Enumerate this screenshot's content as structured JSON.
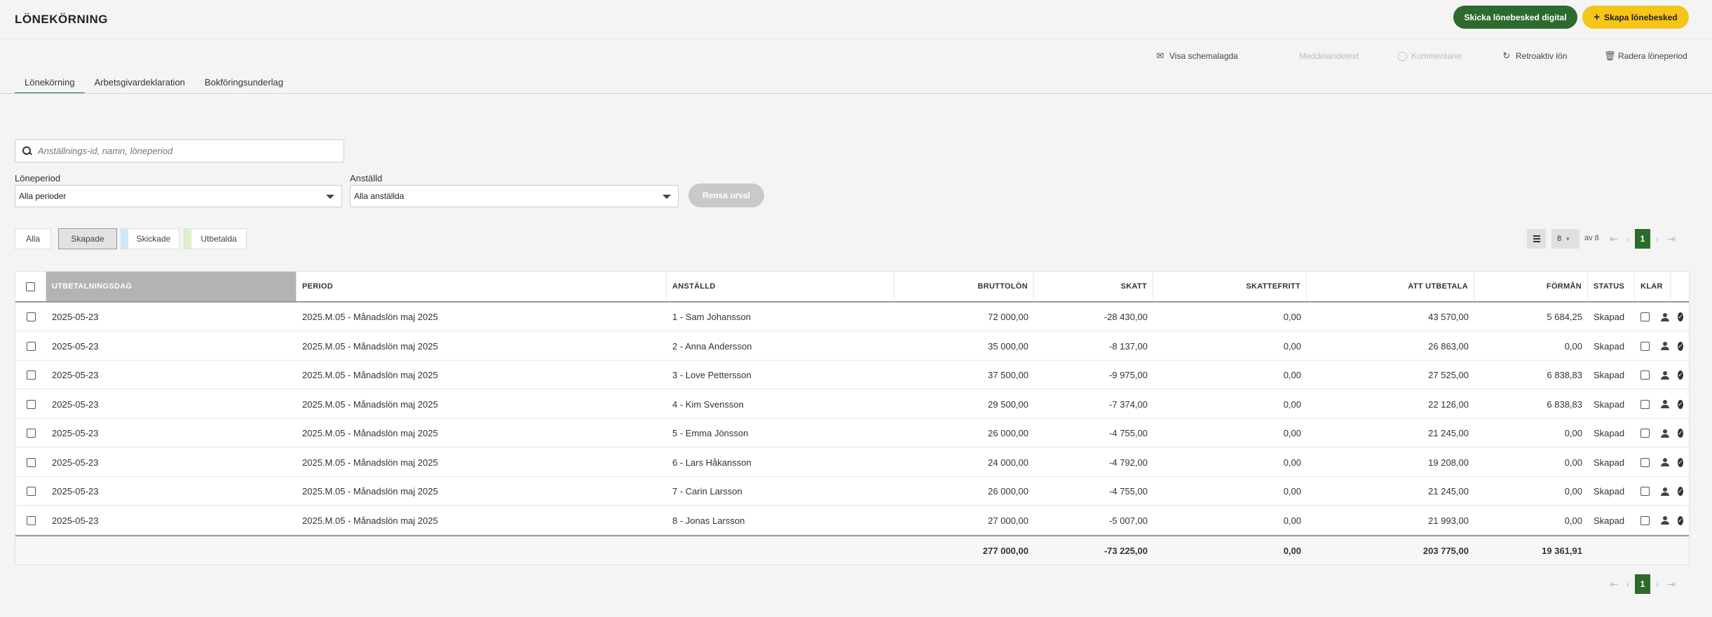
{
  "header": {
    "title": "LÖNEKÖRNING",
    "send_digital_label": "Skicka lönebesked digital",
    "create_label": "Skapa lönebesked"
  },
  "actions": [
    {
      "label": "Visa schemalagda",
      "icon": "envelope-icon",
      "enabled": true
    },
    {
      "label": "Meddelandetext",
      "icon": "",
      "enabled": false
    },
    {
      "label": "Kommentarer",
      "icon": "comment-icon",
      "enabled": false
    },
    {
      "label": "Retroaktiv lön",
      "icon": "refresh-icon",
      "enabled": true
    },
    {
      "label": "Radera löneperiod",
      "icon": "trash-icon",
      "enabled": true
    }
  ],
  "tabs": [
    {
      "label": "Lönekörning",
      "active": true
    },
    {
      "label": "Arbetsgivardeklaration",
      "active": false
    },
    {
      "label": "Bokföringsunderlag",
      "active": false
    }
  ],
  "search": {
    "placeholder": "Anställnings-id, namn, löneperiod"
  },
  "filters": {
    "period_label": "Löneperiod",
    "period_value": "Alla perioder",
    "employee_label": "Anställd",
    "employee_value": "Alla anställda",
    "clear_label": "Rensa urval"
  },
  "status_chips": [
    {
      "label": "Alla",
      "color": "",
      "active": false
    },
    {
      "label": "Skapade",
      "color": "",
      "active": true
    },
    {
      "label": "Skickade",
      "color": "#cfe6f7",
      "active": false
    },
    {
      "label": "Utbetalda",
      "color": "#dff0c9",
      "active": false
    }
  ],
  "pagination": {
    "per_page": "8",
    "of_text": "av 8",
    "current_page": "1"
  },
  "table": {
    "columns": [
      "UTBETALNINGSDAG",
      "PERIOD",
      "ANSTÄLLD",
      "BRUTTOLÖN",
      "SKATT",
      "SKATTEFRITT",
      "ATT UTBETALA",
      "FÖRMÅN",
      "STATUS",
      "KLAR"
    ],
    "rows": [
      {
        "date": "2025-05-23",
        "period": "2025.M.05 - Månadslön maj 2025",
        "employee": "1 - Sam Johansson",
        "gross": "72 000,00",
        "tax": "-28 430,00",
        "taxfree": "0,00",
        "pay": "43 570,00",
        "benefit": "5 684,25",
        "status": "Skapad"
      },
      {
        "date": "2025-05-23",
        "period": "2025.M.05 - Månadslön maj 2025",
        "employee": "2 - Anna Andersson",
        "gross": "35 000,00",
        "tax": "-8 137,00",
        "taxfree": "0,00",
        "pay": "26 863,00",
        "benefit": "0,00",
        "status": "Skapad"
      },
      {
        "date": "2025-05-23",
        "period": "2025.M.05 - Månadslön maj 2025",
        "employee": "3 - Love Pettersson",
        "gross": "37 500,00",
        "tax": "-9 975,00",
        "taxfree": "0,00",
        "pay": "27 525,00",
        "benefit": "6 838,83",
        "status": "Skapad"
      },
      {
        "date": "2025-05-23",
        "period": "2025.M.05 - Månadslön maj 2025",
        "employee": "4 - Kim Svensson",
        "gross": "29 500,00",
        "tax": "-7 374,00",
        "taxfree": "0,00",
        "pay": "22 126,00",
        "benefit": "6 838,83",
        "status": "Skapad"
      },
      {
        "date": "2025-05-23",
        "period": "2025.M.05 - Månadslön maj 2025",
        "employee": "5 - Emma Jönsson",
        "gross": "26 000,00",
        "tax": "-4 755,00",
        "taxfree": "0,00",
        "pay": "21 245,00",
        "benefit": "0,00",
        "status": "Skapad"
      },
      {
        "date": "2025-05-23",
        "period": "2025.M.05 - Månadslön maj 2025",
        "employee": "6 - Lars Håkansson",
        "gross": "24 000,00",
        "tax": "-4 792,00",
        "taxfree": "0,00",
        "pay": "19 208,00",
        "benefit": "0,00",
        "status": "Skapad"
      },
      {
        "date": "2025-05-23",
        "period": "2025.M.05 - Månadslön maj 2025",
        "employee": "7 - Carin Larsson",
        "gross": "26 000,00",
        "tax": "-4 755,00",
        "taxfree": "0,00",
        "pay": "21 245,00",
        "benefit": "0,00",
        "status": "Skapad"
      },
      {
        "date": "2025-05-23",
        "period": "2025.M.05 - Månadslön maj 2025",
        "employee": "8 - Jonas Larsson",
        "gross": "27 000,00",
        "tax": "-5 007,00",
        "taxfree": "0,00",
        "pay": "21 993,00",
        "benefit": "0,00",
        "status": "Skapad"
      }
    ],
    "totals": {
      "gross": "277 000,00",
      "tax": "-73 225,00",
      "taxfree": "0,00",
      "pay": "203 775,00",
      "benefit": "19 361,91"
    }
  },
  "colors": {
    "brand_green": "#2d6a2e",
    "accent_yellow": "#f5c518"
  }
}
